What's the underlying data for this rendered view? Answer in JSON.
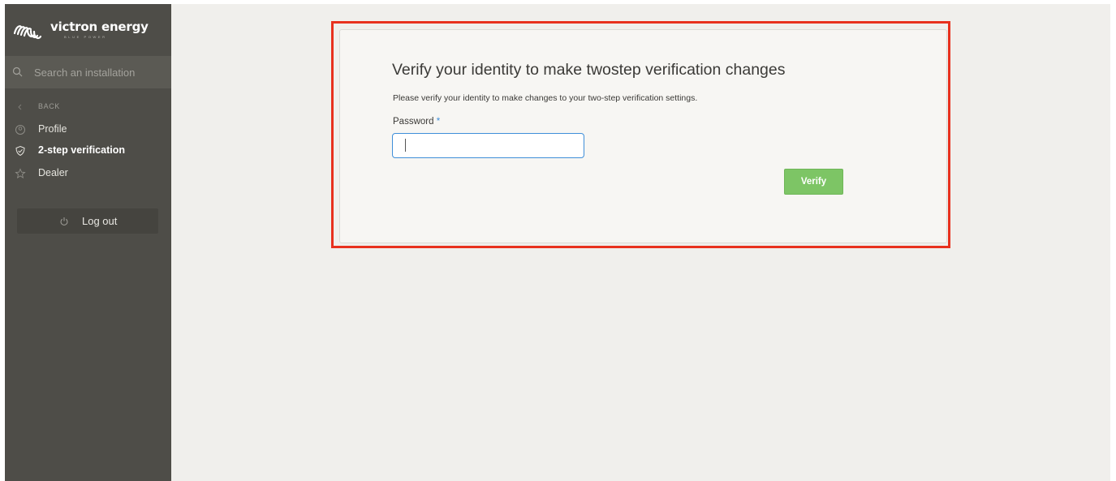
{
  "brand": {
    "name": "victron energy",
    "tagline": "BLUE POWER"
  },
  "search": {
    "placeholder": "Search an installation"
  },
  "sidebar": {
    "back_label": "BACK",
    "items": [
      {
        "label": "Profile",
        "icon": "profile-icon"
      },
      {
        "label": "2-step verification",
        "icon": "shield-check-icon",
        "active": true
      },
      {
        "label": "Dealer",
        "icon": "star-icon"
      }
    ],
    "logout_label": "Log out"
  },
  "main": {
    "title": "Verify your identity to make twostep verification changes",
    "description": "Please verify your identity to make changes to your two-step verification settings.",
    "password_label": "Password",
    "required_marker": "*",
    "password_value": "",
    "verify_label": "Verify"
  },
  "colors": {
    "sidebar": "#4e4d48",
    "background": "#f0efec",
    "accent_blue": "#3f8fd9",
    "verify_green": "#7dc565",
    "highlight_red": "#e8311e"
  }
}
